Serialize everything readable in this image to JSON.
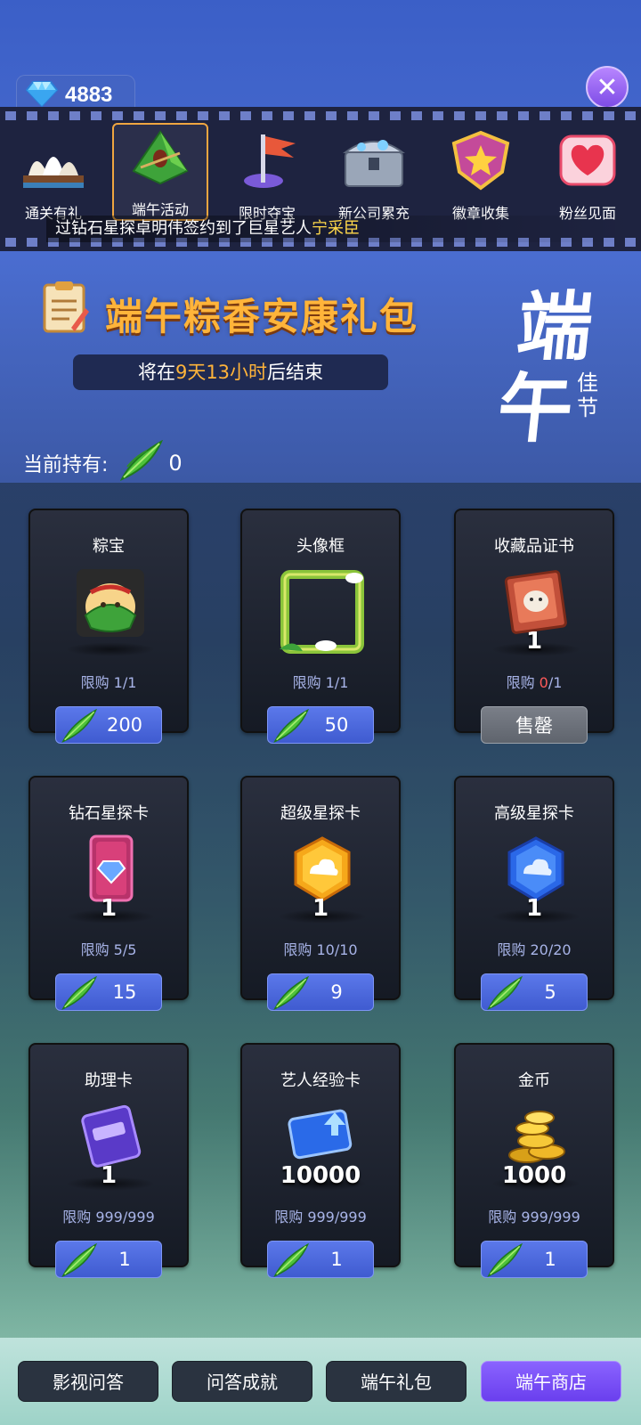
{
  "currency": {
    "gems": "4883",
    "icon": "diamond-icon"
  },
  "nav_tabs": [
    {
      "label": "通关有礼",
      "icon": "opera-house-icon"
    },
    {
      "label": "端午活动",
      "icon": "zongzi-icon"
    },
    {
      "label": "限时夺宝",
      "icon": "flag-icon"
    },
    {
      "label": "新公司累充",
      "icon": "treasure-chest-icon"
    },
    {
      "label": "徽章收集",
      "icon": "badge-icon"
    },
    {
      "label": "粉丝见面",
      "icon": "heart-icon"
    }
  ],
  "ticker": {
    "prefix": "过钻石星探卓明伟签约到了巨星艺人",
    "highlight": "宁采臣"
  },
  "banner": {
    "title": "端午粽香安康礼包",
    "countdown_prefix": "将在",
    "countdown_time": "9天13小时",
    "countdown_suffix": "后结束",
    "brush_1": "端",
    "brush_2": "午",
    "brush_3": "佳节"
  },
  "holding": {
    "label": "当前持有:",
    "value": "0"
  },
  "items": [
    {
      "name": "粽宝",
      "qty": "",
      "limit_prefix": "限购",
      "limit_used": "1",
      "limit_total": "/1",
      "price": "200",
      "icon": "zongzi-character-icon"
    },
    {
      "name": "头像框",
      "qty": "",
      "limit_prefix": "限购",
      "limit_used": "1",
      "limit_total": "/1",
      "price": "50",
      "icon": "bamboo-frame-icon"
    },
    {
      "name": "收藏品证书",
      "qty": "1",
      "limit_prefix": "限购",
      "limit_used": "0",
      "limit_total": "/1",
      "price": "售罄",
      "icon": "certificate-book-icon"
    },
    {
      "name": "钻石星探卡",
      "qty": "1",
      "limit_prefix": "限购",
      "limit_used": "5",
      "limit_total": "/5",
      "price": "15",
      "icon": "diamond-card-icon"
    },
    {
      "name": "超级星探卡",
      "qty": "1",
      "limit_prefix": "限购",
      "limit_used": "10",
      "limit_total": "/10",
      "price": "9",
      "icon": "gold-hexagon-icon"
    },
    {
      "name": "高级星探卡",
      "qty": "1",
      "limit_prefix": "限购",
      "limit_used": "20",
      "limit_total": "/20",
      "price": "5",
      "icon": "blue-hexagon-icon"
    },
    {
      "name": "助理卡",
      "qty": "1",
      "limit_prefix": "限购",
      "limit_used": "999",
      "limit_total": "/999",
      "price": "1",
      "icon": "assistant-card-icon"
    },
    {
      "name": "艺人经验卡",
      "qty": "10000",
      "limit_prefix": "限购",
      "limit_used": "999",
      "limit_total": "/999",
      "price": "1",
      "icon": "exp-card-icon"
    },
    {
      "name": "金币",
      "qty": "1000",
      "limit_prefix": "限购",
      "limit_used": "999",
      "limit_total": "/999",
      "price": "1",
      "icon": "gold-coins-icon"
    }
  ],
  "bottom_tabs": [
    "影视问答",
    "问答成就",
    "端午礼包",
    "端午商店"
  ],
  "colors": {
    "accent_orange": "#ffb43a",
    "buy_blue": "#4f6ade",
    "active_purple": "#7a50f5",
    "sold_gray": "#6e737c",
    "limit_red": "#ff5a5a"
  }
}
